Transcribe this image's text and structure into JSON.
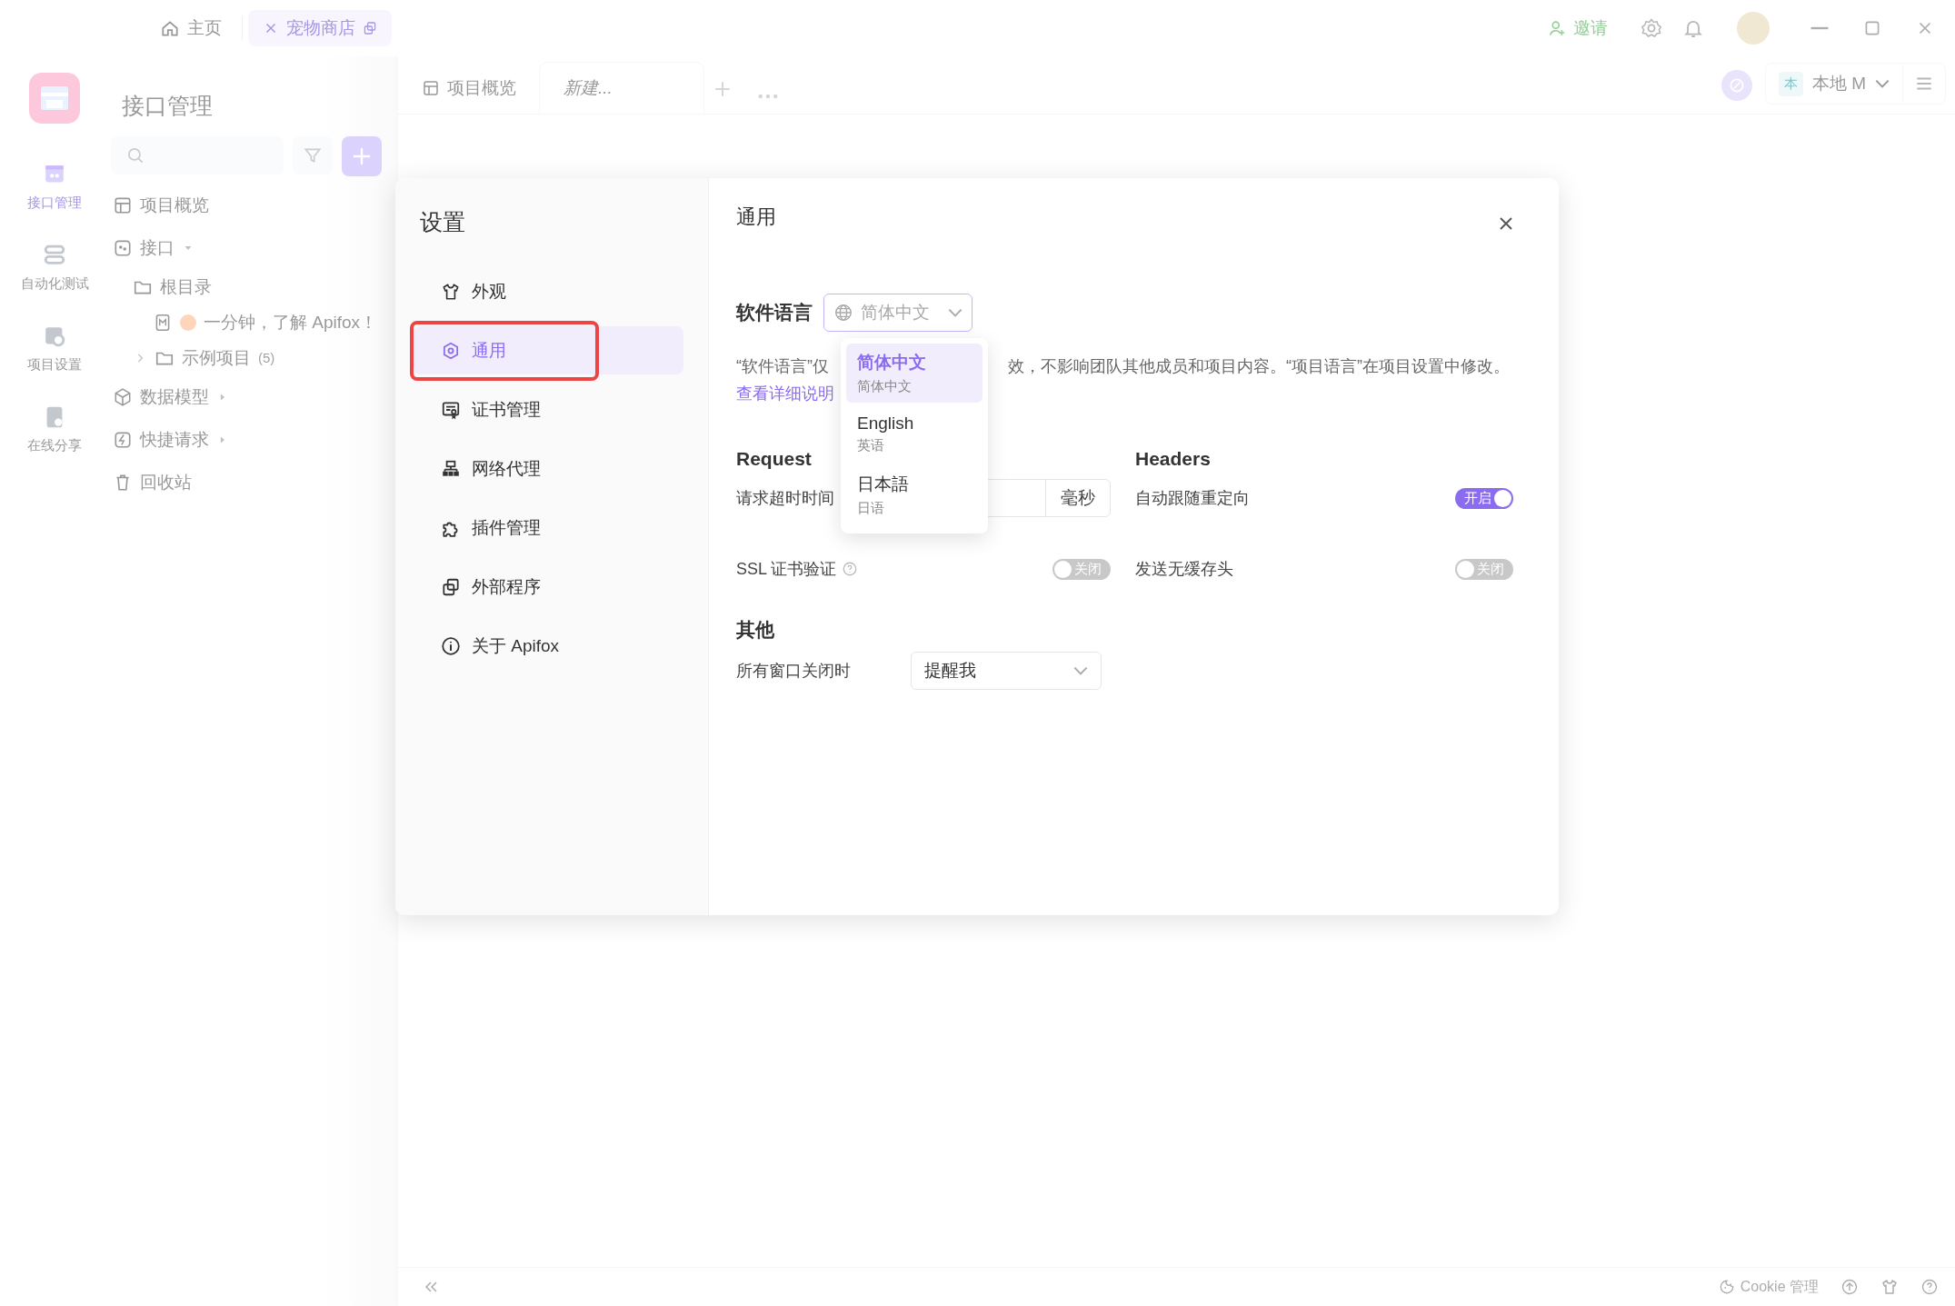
{
  "titlebar": {
    "tabs": [
      {
        "label": "主页",
        "kind": "home",
        "selected": false
      },
      {
        "label": "宠物商店",
        "kind": "project",
        "selected": true
      }
    ],
    "invite": "邀请"
  },
  "rail": [
    {
      "label": "接口管理",
      "kind": "api",
      "selected": true
    },
    {
      "label": "自动化测试",
      "kind": "test",
      "selected": false
    },
    {
      "label": "项目设置",
      "kind": "settings",
      "selected": false
    },
    {
      "label": "在线分享",
      "kind": "share",
      "selected": false
    }
  ],
  "tree_panel": {
    "title": "接口管理",
    "items": [
      {
        "label": "项目概览",
        "kind": "overview"
      },
      {
        "label": "接口",
        "kind": "api",
        "expanded": true,
        "children": [
          {
            "label": "根目录",
            "kind": "folder",
            "children": [
              {
                "label": "一分钟，了解 Apifox！",
                "kind": "doc"
              }
            ]
          },
          {
            "label": "示例项目",
            "kind": "folder",
            "count": "(5)",
            "expanded": false
          }
        ]
      },
      {
        "label": "数据模型",
        "kind": "model",
        "expanded": false
      },
      {
        "label": "快捷请求",
        "kind": "quick",
        "expanded": false
      },
      {
        "label": "回收站",
        "kind": "trash"
      }
    ]
  },
  "main_tabs": [
    {
      "label": "项目概览",
      "kind": "overview",
      "selected": false
    },
    {
      "label": "新建...",
      "kind": "new",
      "selected": true
    }
  ],
  "environment": {
    "badge": "本",
    "label": "本地 M"
  },
  "status_bar": {
    "cookie": "Cookie 管理"
  },
  "settings_dialog": {
    "title": "设置",
    "menu": [
      {
        "label": "外观",
        "kind": "appearance",
        "selected": false
      },
      {
        "label": "通用",
        "kind": "general",
        "selected": true
      },
      {
        "label": "证书管理",
        "kind": "cert",
        "selected": false
      },
      {
        "label": "网络代理",
        "kind": "proxy",
        "selected": false
      },
      {
        "label": "插件管理",
        "kind": "plugin",
        "selected": false
      },
      {
        "label": "外部程序",
        "kind": "external",
        "selected": false
      },
      {
        "label": "关于 Apifox",
        "kind": "about",
        "selected": false
      }
    ],
    "panel": {
      "title": "通用",
      "language": {
        "label": "软件语言",
        "value": "简体中文",
        "options": [
          {
            "label": "简体中文",
            "sublabel": "简体中文",
            "selected": true
          },
          {
            "label": "English",
            "sublabel": "英语",
            "selected": false
          },
          {
            "label": "日本語",
            "sublabel": "日语",
            "selected": false
          }
        ]
      },
      "description_start": "“软件语言”仅",
      "description_end": "效，不影响团队其他成员和项目内容。“项目语言”在项目设置中修改。",
      "details_link": "查看详细说明",
      "request": {
        "title": "Request",
        "rows": [
          {
            "kind": "input",
            "label": "请求超时时间",
            "unit": "毫秒"
          },
          {
            "kind": "toggle",
            "label": "SSL 证书验证",
            "help": true,
            "on": false,
            "state_text": "关闭"
          }
        ]
      },
      "headers": {
        "title": "Headers",
        "rows": [
          {
            "kind": "toggle",
            "label": "自动跟随重定向",
            "on": true,
            "state_text": "开启"
          },
          {
            "kind": "toggle",
            "label": "发送无缓存头",
            "on": false,
            "state_text": "关闭"
          }
        ]
      },
      "other": {
        "title": "其他",
        "label": "所有窗口关闭时",
        "value": "提醒我"
      }
    }
  }
}
